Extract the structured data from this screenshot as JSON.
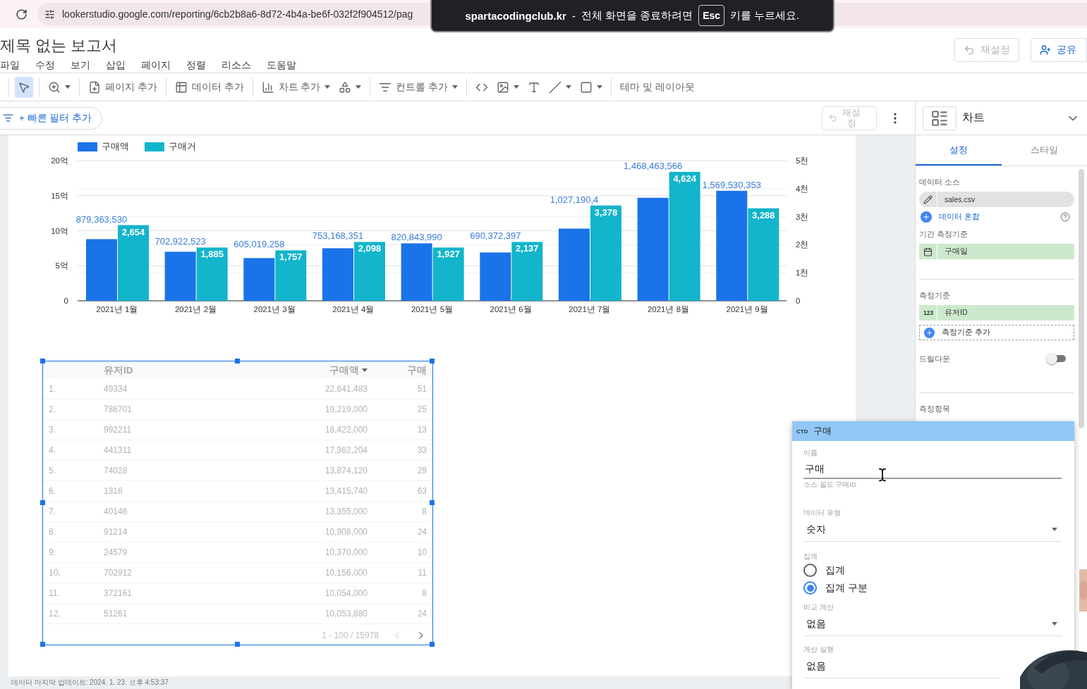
{
  "browser": {
    "url": "lookerstudio.google.com/reporting/6cb2b8a6-8d72-4b4a-be6f-032f2f904512/pag"
  },
  "fullscreen_notice": {
    "site": "spartacodingclub.kr",
    "separator": "-",
    "message": "전체 화면을 종료하려면",
    "key": "Esc",
    "message_end": "키를 누르세요."
  },
  "report": {
    "title": "제목 없는 보고서",
    "menu": [
      "파일",
      "수정",
      "보기",
      "삽입",
      "페이지",
      "정렬",
      "리소스",
      "도움말"
    ],
    "reset_button": {
      "label": "재설정",
      "disabled": true
    },
    "share_button": {
      "label": "공유"
    }
  },
  "toolbar": {
    "groups": [
      {
        "items": [
          {
            "selected": true,
            "caret": false
          }
        ]
      },
      {
        "items": [
          {
            "selected": false,
            "caret": true
          }
        ]
      },
      {
        "items": [
          {
            "label": "페이지 추가",
            "selected": false,
            "caret": false
          }
        ]
      },
      {
        "items": [
          {
            "label": "데이터 추가",
            "selected": false,
            "caret": false
          }
        ]
      },
      {
        "items": [
          {
            "label": "차트 추가",
            "selected": false,
            "caret": true
          },
          {
            "selected": false,
            "caret": true
          }
        ]
      },
      {
        "items": [
          {
            "label": "컨트롤 추가",
            "selected": false,
            "caret": true
          }
        ]
      },
      {
        "items": [
          {
            "selected": false,
            "caret": false
          },
          {
            "selected": false,
            "caret": true
          },
          {
            "selected": false,
            "caret": false
          },
          {
            "selected": false,
            "caret": true
          },
          {
            "selected": false,
            "caret": true
          }
        ]
      },
      {
        "items": [
          {
            "label": "테마 및 레이아웃",
            "selected": false,
            "caret": false
          }
        ]
      }
    ]
  },
  "filter_bar": {
    "add_filter": "+ 빠른 필터 추가",
    "reset_button": {
      "label": "재설정",
      "disabled": true
    }
  },
  "chart": {
    "chart_data": {
      "type": "bar",
      "categories": [
        "2021년 1월",
        "2021년 2월",
        "2021년 3월",
        "2021년 4월",
        "2021년 5월",
        "2021년 6월",
        "2021년 7월",
        "2021년 8월",
        "2021년 9월"
      ],
      "series": [
        {
          "name": "구매액",
          "color": "#1a73e8",
          "values": [
            8.8,
            7.0,
            6.1,
            7.5,
            8.2,
            6.9,
            10.3,
            14.7,
            15.7
          ]
        },
        {
          "name": "구매거",
          "color": "#12b5cb",
          "axis": "y2",
          "values": [
            2.7,
            1.9,
            1.8,
            2.1,
            1.9,
            2.1,
            3.4,
            4.6,
            3.3
          ]
        }
      ],
      "ylim": [
        0,
        20
      ],
      "yticks": [
        {
          "value": 0,
          "label": "0"
        },
        {
          "value": 5,
          "label": "5억"
        },
        {
          "value": 10,
          "label": "10억"
        },
        {
          "value": 15,
          "label": "15억"
        },
        {
          "value": 20,
          "label": "20억"
        }
      ],
      "y2lim": [
        0,
        5
      ],
      "y2ticks": [
        {
          "value": 0,
          "label": "0"
        },
        {
          "value": 1,
          "label": "1천"
        },
        {
          "value": 2,
          "label": "2천"
        },
        {
          "value": 3,
          "label": "3천"
        },
        {
          "value": 4,
          "label": "4천"
        },
        {
          "value": 5,
          "label": "5천"
        }
      ],
      "grid": true,
      "annotations": [
        "879,363,530",
        "702,922,523",
        "605,019,258",
        "753,168,351",
        "820,843,990",
        "690,372,397",
        "1,027,190,4",
        "1,468,463,566",
        "1,569,530,353",
        "2,654",
        "1,885",
        "1,757",
        "2,098",
        "1,927",
        "2,137",
        "3,378",
        "4,624",
        "3,288"
      ]
    }
  },
  "table": {
    "columns": [
      null,
      {
        "label": "유저ID",
        "sorted": false
      },
      {
        "label": "구매액",
        "sorted": true
      },
      {
        "label": "구매",
        "sorted": false
      }
    ],
    "rows": [
      [
        "1.",
        "49334",
        "22,641,483",
        "51"
      ],
      [
        "2.",
        "786701",
        "19,219,000",
        "25"
      ],
      [
        "3.",
        "992211",
        "18,422,000",
        "13"
      ],
      [
        "4.",
        "441311",
        "17,362,204",
        "33"
      ],
      [
        "5.",
        "74028",
        "13,874,120",
        "29"
      ],
      [
        "6.",
        "1316",
        "13,415,740",
        "63"
      ],
      [
        "7.",
        "40146",
        "13,355,000",
        "8"
      ],
      [
        "8.",
        "91214",
        "10,908,000",
        "24"
      ],
      [
        "9.",
        "24579",
        "10,370,000",
        "10"
      ],
      [
        "10.",
        "702912",
        "10,156,000",
        "11"
      ],
      [
        "11.",
        "372161",
        "10,054,000",
        "8"
      ],
      [
        "12.",
        "51261",
        "10,053,880",
        "24"
      ]
    ],
    "pagination": "1 - 100 / 15978"
  },
  "footer": "데이터 마지막 업데이트: 2024. 1. 23. 오후 4:53:37",
  "panel": {
    "title": "차트",
    "tabs": [
      {
        "label": "설정",
        "selected": true
      },
      {
        "label": "스타일",
        "selected": false
      }
    ],
    "data_source": {
      "heading": "데이터 소스",
      "source": "sales.csv",
      "blend": "데이터 혼합"
    },
    "date_dimension": {
      "heading": "기간 측정기준",
      "field": "구매일"
    },
    "dimension": {
      "heading": "측정기준",
      "field_type": "123",
      "field": "유저ID",
      "add": "측정기준 추가"
    },
    "drilldown": {
      "label": "드릴다운",
      "on": false
    },
    "metric": {
      "heading": "측정항목"
    }
  },
  "field_editor": {
    "type_badge": "CTD",
    "title": "구매",
    "name_label": "이름",
    "name_value": "구매",
    "source_hint": "소스 필드 구매ID",
    "data_type": {
      "label": "데이터 유형",
      "value": "숫자"
    },
    "aggregation": {
      "label": "집계",
      "options": [
        {
          "label": "집계",
          "selected": false
        },
        {
          "label": "집계 구분",
          "selected": true
        }
      ]
    },
    "comparison": {
      "label": "비교 계산",
      "value": "없음"
    },
    "running": {
      "label": "계산 실행",
      "value": "없음"
    }
  }
}
